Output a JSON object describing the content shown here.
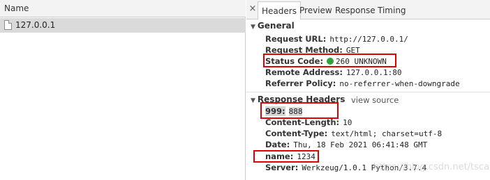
{
  "left": {
    "column_header": "Name",
    "requests": [
      {
        "name": "127.0.0.1",
        "icon": "document-icon"
      }
    ]
  },
  "tabs": {
    "close": "×",
    "items": [
      "Headers",
      "Preview",
      "Response",
      "Timing"
    ],
    "active": "Headers"
  },
  "general": {
    "title": "General",
    "rows": [
      {
        "key": "Request URL:",
        "value": "http://127.0.0.1/"
      },
      {
        "key": "Request Method:",
        "value": "GET"
      },
      {
        "key": "Status Code:",
        "value": "260 UNKNOWN",
        "status_dot_color": "#2fa33a"
      },
      {
        "key": "Remote Address:",
        "value": "127.0.0.1:80"
      },
      {
        "key": "Referrer Policy:",
        "value": "no-referrer-when-downgrade"
      }
    ]
  },
  "response_headers": {
    "title": "Response Headers",
    "view_source": "view source",
    "rows": [
      {
        "key": "999:",
        "value": "888"
      },
      {
        "key": "Content-Length:",
        "value": "10"
      },
      {
        "key": "Content-Type:",
        "value": "text/html; charset=utf-8"
      },
      {
        "key": "Date:",
        "value": "Thu, 18 Feb 2021 06:41:48 GMT"
      },
      {
        "key": "name:",
        "value": "1234"
      },
      {
        "key": "Server:",
        "value": "Werkzeug/1.0.1 Python/3.7.4"
      }
    ]
  },
  "watermark": "https://blog.csdn.net/tscaxx",
  "highlight_color": "#e00000"
}
